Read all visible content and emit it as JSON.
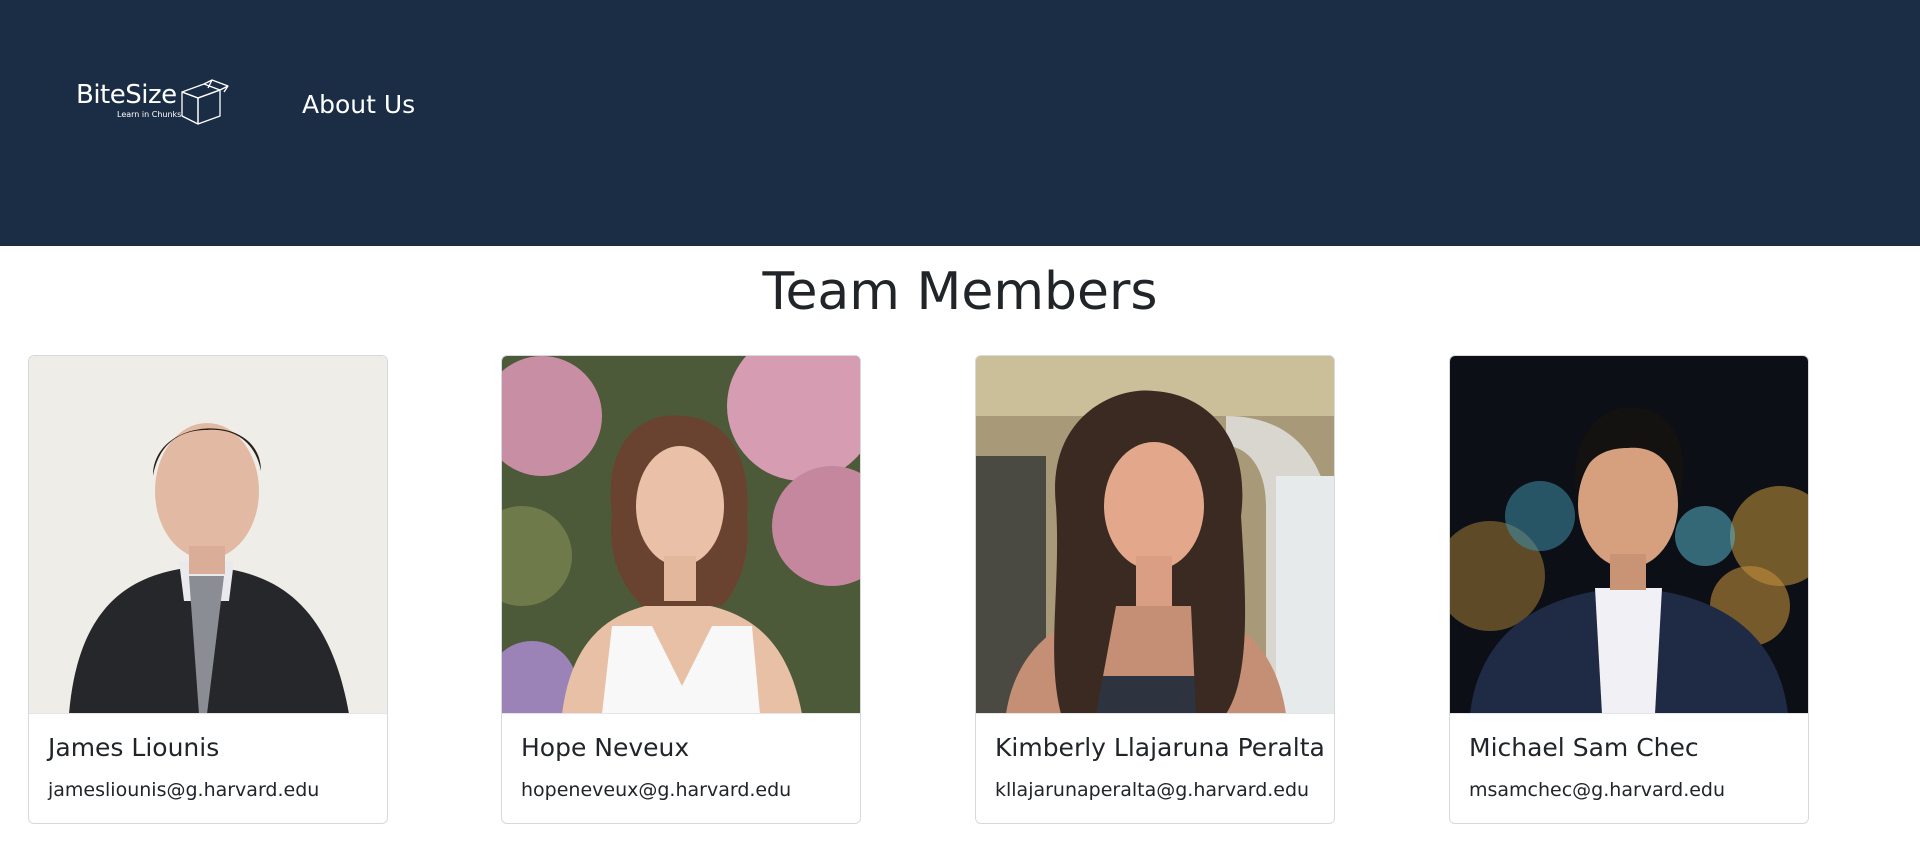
{
  "nav": {
    "brand_name": "BiteSize",
    "brand_tagline": "Learn in Chunks",
    "brand_icon": "cube-icon",
    "links": [
      "About Us"
    ],
    "background": "#1b2d45"
  },
  "page": {
    "title": "Team Members"
  },
  "team": [
    {
      "name": "James Liounis",
      "email": "jamesliounis@g.harvard.edu",
      "photo": "portrait-photo"
    },
    {
      "name": "Hope Neveux",
      "email": "hopeneveux@g.harvard.edu",
      "photo": "portrait-photo"
    },
    {
      "name": "Kimberly Llajaruna Peralta",
      "email": "kllajarunaperalta@g.harvard.edu",
      "photo": "portrait-photo"
    },
    {
      "name": "Michael Sam Chec",
      "email": "msamchec@g.harvard.edu",
      "photo": "portrait-photo"
    }
  ]
}
